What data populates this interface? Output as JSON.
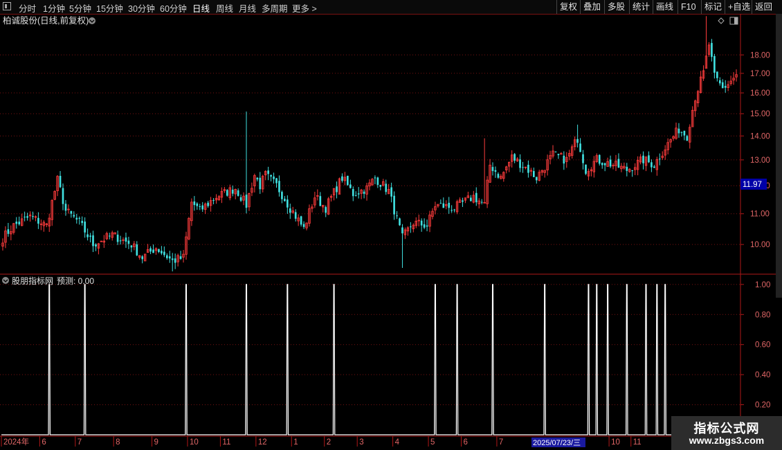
{
  "toolbar": {
    "left_items": [
      "分时",
      "1分钟",
      "5分钟",
      "15分钟",
      "30分钟",
      "60分钟",
      "日线",
      "周线",
      "月线",
      "多周期",
      "更多 >"
    ],
    "active": "日线",
    "right_items": [
      "复权",
      "叠加",
      "多股",
      "统计",
      "画线",
      "F10",
      "标记",
      "+自选",
      "返回"
    ]
  },
  "main_title": "柏诚股份(日线,前复权)",
  "indicator_title": "股朋指标网",
  "indicator_label": "预测: 0.00",
  "price_tag": "11.97",
  "date_highlight": "2025/07/23/三",
  "watermark": {
    "line1": "指标公式网",
    "line2": "www.zbgs3.com"
  },
  "colors": {
    "up": "#ff3c3c",
    "down": "#40e0e0",
    "axis": "#b01818",
    "grid": "#7a1212",
    "price_tag_bg": "#0000a8",
    "signal": "#ffffff"
  },
  "chart_data": {
    "type": "candlestick",
    "price_axis": {
      "ticks": [
        10.0,
        11.0,
        12.0,
        13.0,
        14.0,
        15.0,
        16.0,
        17.0,
        18.0
      ],
      "range": [
        9.2,
        19.5
      ],
      "scale": "log"
    },
    "indicator_axis": {
      "ticks": [
        "0.20",
        "0.40",
        "0.60",
        "0.80",
        "1.00"
      ],
      "range": [
        0,
        1.05
      ]
    },
    "x_labels": [
      {
        "i": 0,
        "t": "2024年"
      },
      {
        "i": 14,
        "t": "6"
      },
      {
        "i": 27,
        "t": "7"
      },
      {
        "i": 41,
        "t": "8"
      },
      {
        "i": 55,
        "t": "9"
      },
      {
        "i": 68,
        "t": "10"
      },
      {
        "i": 80,
        "t": "11"
      },
      {
        "i": 93,
        "t": "12"
      },
      {
        "i": 106,
        "t": "1"
      },
      {
        "i": 118,
        "t": "2"
      },
      {
        "i": 130,
        "t": "3"
      },
      {
        "i": 143,
        "t": "4"
      },
      {
        "i": 156,
        "t": "5"
      },
      {
        "i": 168,
        "t": "6"
      },
      {
        "i": 181,
        "t": "7"
      },
      {
        "i": 222,
        "t": "10"
      },
      {
        "i": 230,
        "t": "11"
      }
    ],
    "close_points": [
      [
        0,
        10.2
      ],
      [
        4,
        10.6
      ],
      [
        10,
        10.9
      ],
      [
        16,
        10.6
      ],
      [
        20,
        12.2
      ],
      [
        23,
        11.1
      ],
      [
        28,
        10.7
      ],
      [
        33,
        10.0
      ],
      [
        40,
        10.3
      ],
      [
        47,
        10.0
      ],
      [
        51,
        9.6
      ],
      [
        56,
        9.9
      ],
      [
        62,
        9.5
      ],
      [
        66,
        9.6
      ],
      [
        69,
        11.4
      ],
      [
        72,
        11.1
      ],
      [
        78,
        11.6
      ],
      [
        85,
        11.9
      ],
      [
        89,
        11.3
      ],
      [
        92,
        12.4
      ],
      [
        94,
        12.0
      ],
      [
        96,
        12.4
      ],
      [
        100,
        12.0
      ],
      [
        105,
        11.2
      ],
      [
        110,
        10.5
      ],
      [
        114,
        11.6
      ],
      [
        118,
        11.2
      ],
      [
        124,
        12.3
      ],
      [
        128,
        11.7
      ],
      [
        133,
        11.9
      ],
      [
        136,
        12.3
      ],
      [
        141,
        11.8
      ],
      [
        144,
        10.8
      ],
      [
        146,
        10.2
      ],
      [
        150,
        10.7
      ],
      [
        155,
        10.6
      ],
      [
        158,
        11.3
      ],
      [
        165,
        11.2
      ],
      [
        172,
        11.6
      ],
      [
        176,
        11.3
      ],
      [
        178,
        12.8
      ],
      [
        182,
        12.3
      ],
      [
        186,
        13.1
      ],
      [
        191,
        12.7
      ],
      [
        195,
        12.3
      ],
      [
        201,
        13.2
      ],
      [
        206,
        13.0
      ],
      [
        210,
        13.9
      ],
      [
        213,
        12.6
      ],
      [
        217,
        13.0
      ],
      [
        223,
        12.8
      ],
      [
        228,
        12.6
      ],
      [
        234,
        13.0
      ],
      [
        238,
        12.8
      ],
      [
        242,
        13.5
      ],
      [
        247,
        14.3
      ],
      [
        250,
        14.0
      ],
      [
        253,
        15.8
      ],
      [
        256,
        17.0
      ],
      [
        258,
        18.6
      ],
      [
        260,
        16.8
      ],
      [
        263,
        16.2
      ],
      [
        266,
        16.6
      ],
      [
        268,
        16.9
      ]
    ],
    "extreme_highs": [
      [
        20,
        12.4
      ],
      [
        89,
        15.1
      ],
      [
        176,
        13.9
      ],
      [
        210,
        14.5
      ],
      [
        257,
        20.3
      ]
    ],
    "extreme_lows": [
      [
        146,
        9.3
      ],
      [
        62,
        9.2
      ]
    ],
    "signal_bars": [
      17,
      30,
      67,
      89,
      104,
      121,
      158,
      166,
      179,
      198,
      214,
      217,
      221,
      228,
      235,
      239,
      242
    ],
    "bar_count": 269
  }
}
